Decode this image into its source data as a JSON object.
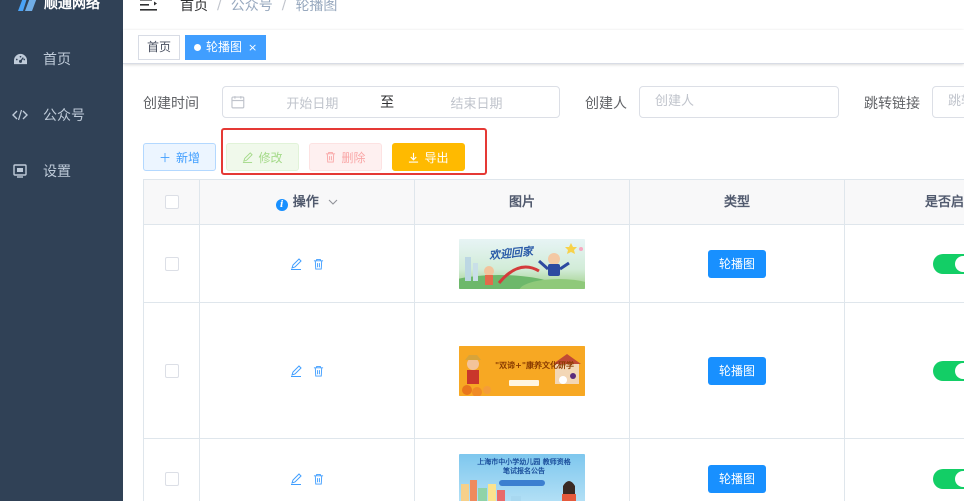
{
  "app": {
    "logo_text": "顺通网络"
  },
  "sidebar": {
    "items": [
      {
        "label": "首页",
        "icon": "dashboard-icon"
      },
      {
        "label": "公众号",
        "icon": "code-icon"
      },
      {
        "label": "设置",
        "icon": "monitor-icon"
      }
    ]
  },
  "breadcrumb": [
    "首页",
    "公众号",
    "轮播图"
  ],
  "tags": [
    {
      "label": "首页",
      "active": false
    },
    {
      "label": "轮播图",
      "active": true,
      "close": "×"
    }
  ],
  "search": {
    "created_time_label": "创建时间",
    "start_placeholder": "开始日期",
    "range_separator": "至",
    "end_placeholder": "结束日期",
    "creator_label": "创建人",
    "creator_placeholder": "创建人",
    "link_label": "跳转链接",
    "link_placeholder": "跳转链接"
  },
  "toolbar": {
    "add_label": "新增",
    "edit_label": "修改",
    "delete_label": "删除",
    "export_label": "导出"
  },
  "table": {
    "columns": [
      "操作",
      "图片",
      "类型",
      "是否启"
    ],
    "rows": [
      {
        "type": "轮播图",
        "enabled": true,
        "banner_text": "欢迎回家",
        "banner_color": "#cfe9d2"
      },
      {
        "type": "轮播图",
        "enabled": true,
        "banner_text": "\"双谛+\"康养文化研学",
        "banner_color": "#f7a823"
      },
      {
        "type": "轮播图",
        "enabled": true,
        "banner_text": "上海市中小学幼儿园 教师资格笔试报名公告",
        "banner_color": "#7ec7ee"
      }
    ]
  },
  "colors": {
    "sidebar_bg": "#304156",
    "primary": "#409eff",
    "switch_on": "#13ce66",
    "export": "#ffba00",
    "highlight": "#e53935"
  }
}
